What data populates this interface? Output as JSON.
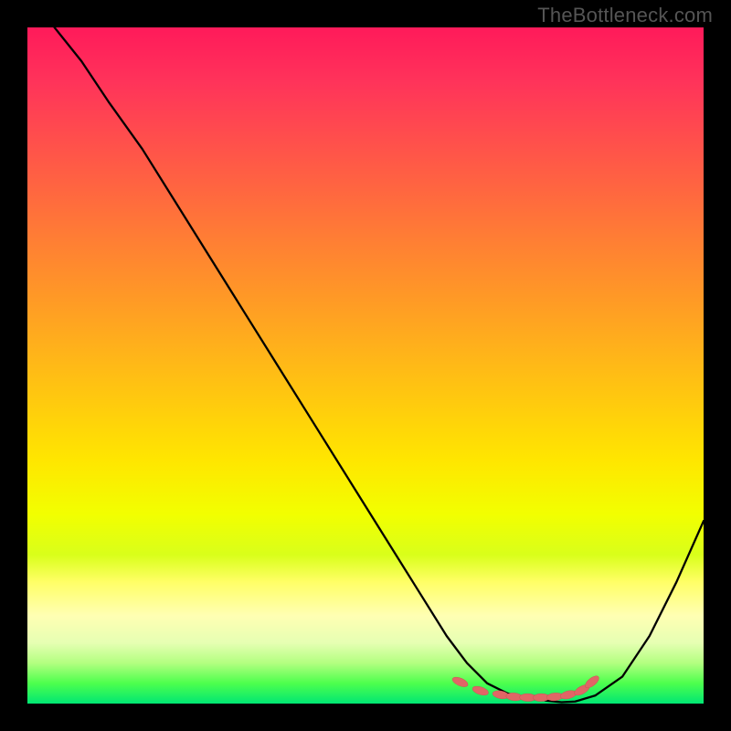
{
  "watermark": "TheBottleneck.com",
  "chart_data": {
    "type": "line",
    "title": "",
    "xlabel": "",
    "ylabel": "",
    "xlim": [
      0,
      100
    ],
    "ylim": [
      0,
      100
    ],
    "background": "rainbow-gradient-red-to-green-vertical",
    "series": [
      {
        "name": "bottleneck-curve",
        "x": [
          4,
          8,
          12,
          17,
          22,
          27,
          32,
          37,
          42,
          47,
          52,
          57,
          62,
          65,
          68,
          71,
          74,
          77,
          79,
          81,
          84,
          88,
          92,
          96,
          100
        ],
        "y": [
          100,
          95,
          89,
          82,
          74,
          66,
          58,
          50,
          42,
          34,
          26,
          18,
          10,
          6,
          3,
          1.5,
          0.8,
          0.4,
          0.2,
          0.3,
          1.2,
          4,
          10,
          18,
          27
        ]
      }
    ],
    "markers": {
      "name": "highlighted-optimal-range",
      "points": [
        {
          "x": 64,
          "y": 3.2
        },
        {
          "x": 67,
          "y": 1.9
        },
        {
          "x": 70,
          "y": 1.3
        },
        {
          "x": 72,
          "y": 1.0
        },
        {
          "x": 74,
          "y": 0.9
        },
        {
          "x": 76,
          "y": 0.9
        },
        {
          "x": 78,
          "y": 1.0
        },
        {
          "x": 80,
          "y": 1.3
        },
        {
          "x": 82,
          "y": 2.0
        },
        {
          "x": 83.5,
          "y": 3.2
        }
      ],
      "color": "#e06666"
    }
  }
}
